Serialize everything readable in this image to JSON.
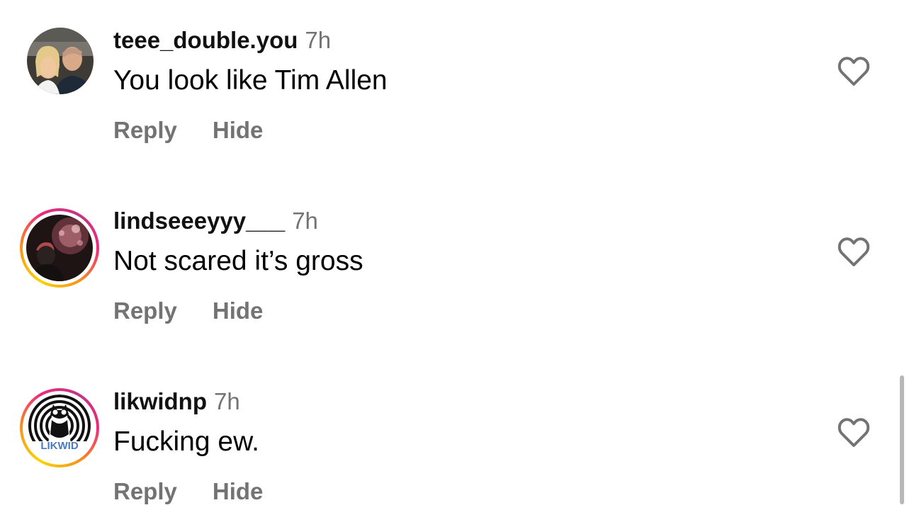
{
  "comments": [
    {
      "username": "teee_double.you",
      "time": "7h",
      "text": "You look like Tim Allen",
      "reply_label": "Reply",
      "hide_label": "Hide",
      "has_story_ring": false,
      "liked": false
    },
    {
      "username": "lindseeeyyy___",
      "time": "7h",
      "text": "Not scared it’s gross",
      "reply_label": "Reply",
      "hide_label": "Hide",
      "has_story_ring": true,
      "liked": false
    },
    {
      "username": "likwidnp",
      "time": "7h",
      "text": "Fucking ew.",
      "reply_label": "Reply",
      "hide_label": "Hide",
      "has_story_ring": true,
      "liked": false,
      "avatar_logo_text": "LIKWID"
    }
  ],
  "icons": {
    "like": "heart-outline-icon"
  },
  "colors": {
    "text_primary": "#000000",
    "text_secondary": "#737373",
    "story_ring": [
      "#fcd405",
      "#f7941d",
      "#ee2a7b",
      "#c13584"
    ]
  }
}
